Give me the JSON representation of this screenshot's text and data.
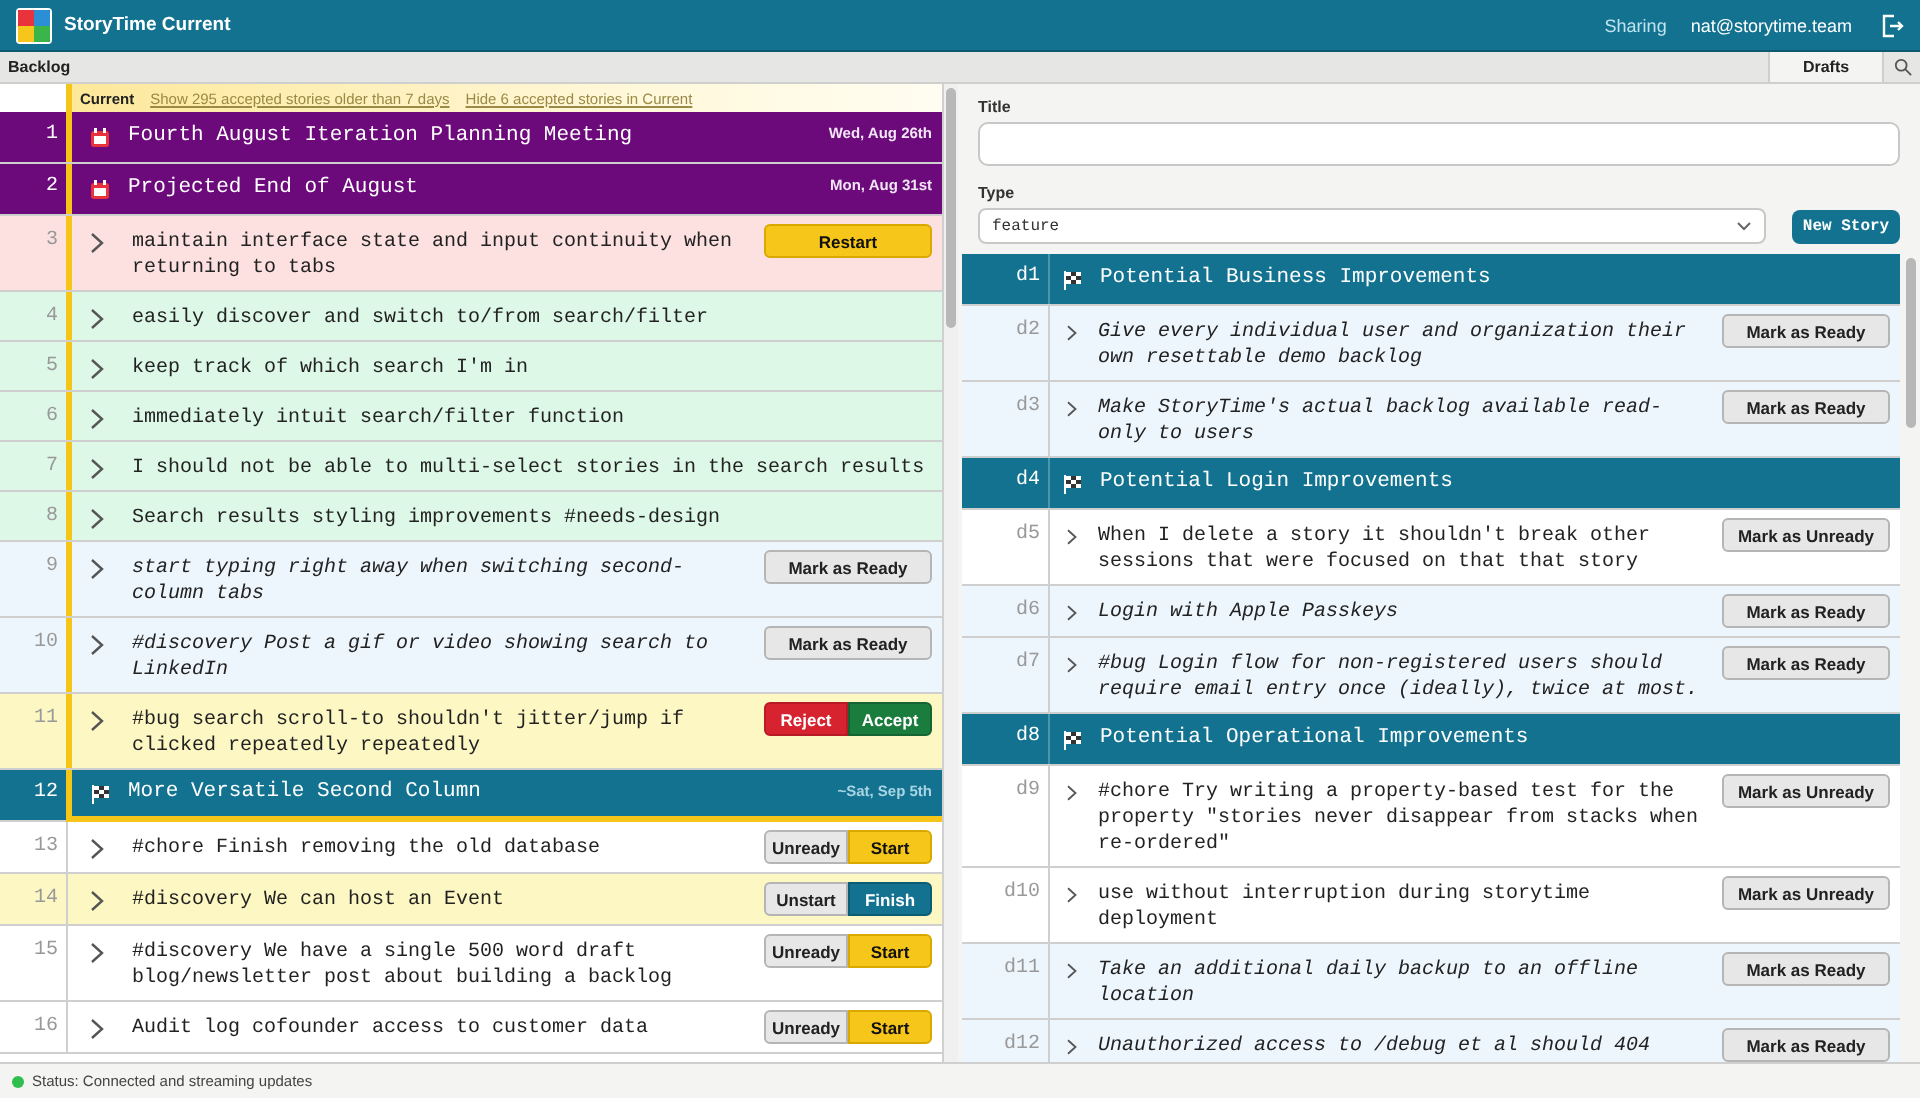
{
  "header": {
    "app_name": "StoryTime Current",
    "links": [
      "Sharing",
      "nat@storytime.team"
    ]
  },
  "backlog": {
    "title": "Backlog",
    "current": {
      "label": "Current",
      "links": [
        "Show 295 accepted stories older than 7 days",
        "Hide 6 accepted stories in Current"
      ],
      "rows": [
        {
          "number": "1",
          "kind": "event",
          "title": "Fourth August Iteration Planning Meeting",
          "date": "Wed, Aug 26th"
        },
        {
          "number": "2",
          "kind": "event",
          "title": "Projected End of August",
          "date": "Mon, Aug 31st"
        },
        {
          "number": "3",
          "kind": "rejected",
          "title": "maintain interface state and input continuity when returning to tabs",
          "buttons": [
            {
              "label": "Restart",
              "kind": "primary"
            }
          ]
        },
        {
          "number": "4",
          "kind": "accepted",
          "title": "easily discover and switch to/from search/filter"
        },
        {
          "number": "5",
          "kind": "accepted",
          "title": "keep track of which search I'm in"
        },
        {
          "number": "6",
          "kind": "accepted",
          "title": "immediately intuit search/filter function"
        },
        {
          "number": "7",
          "kind": "accepted",
          "title": "I should not be able to multi-select stories in the search results"
        },
        {
          "number": "8",
          "kind": "accepted",
          "title": "Search results styling improvements #needs-design"
        },
        {
          "number": "9",
          "kind": "unready",
          "title": "start typing right away when switching second-column tabs",
          "buttons": [
            {
              "label": "Mark as Ready",
              "kind": "neutral"
            }
          ]
        },
        {
          "number": "10",
          "kind": "unready",
          "title": "#discovery Post a gif or video showing search to LinkedIn",
          "buttons": [
            {
              "label": "Mark as Ready",
              "kind": "neutral"
            }
          ]
        },
        {
          "number": "11",
          "kind": "delivered",
          "title": "#bug search scroll-to shouldn't jitter/jump if clicked repeatedly repeatedly",
          "buttons": [
            {
              "label": "Reject",
              "kind": "reject"
            },
            {
              "label": "Accept",
              "kind": "accept"
            }
          ]
        },
        {
          "number": "12",
          "kind": "milestone",
          "title": "More Versatile Second Column",
          "date": "~Sat, Sep 5th"
        }
      ]
    },
    "rows": [
      {
        "number": "13",
        "kind": "ready",
        "title": "#chore Finish removing the old database",
        "buttons": [
          {
            "label": "Unready",
            "kind": "neutral"
          },
          {
            "label": "Start",
            "kind": "primary"
          }
        ]
      },
      {
        "number": "14",
        "kind": "started",
        "title": "#discovery We can host an Event",
        "buttons": [
          {
            "label": "Unstart",
            "kind": "neutral"
          },
          {
            "label": "Finish",
            "kind": "finish"
          }
        ]
      },
      {
        "number": "15",
        "kind": "ready",
        "title": "#discovery We have a single 500 word draft blog/newsletter post about building a backlog",
        "buttons": [
          {
            "label": "Unready",
            "kind": "neutral"
          },
          {
            "label": "Start",
            "kind": "primary"
          }
        ]
      },
      {
        "number": "16",
        "kind": "ready",
        "title": "Audit log cofounder access to customer data",
        "buttons": [
          {
            "label": "Unready",
            "kind": "neutral"
          },
          {
            "label": "Start",
            "kind": "primary"
          }
        ]
      }
    ]
  },
  "drafts": {
    "tabs": [
      {
        "label": "Drafts",
        "selected": true
      }
    ],
    "form": {
      "title_label": "Title",
      "type_label": "Type",
      "type_value": "feature",
      "submit": "New Story"
    },
    "rows": [
      {
        "number": "d1",
        "kind": "milestone",
        "title": "Potential Business Improvements"
      },
      {
        "number": "d2",
        "kind": "unready",
        "title": "Give every individual user and organization their own resettable demo backlog",
        "buttons": [
          {
            "label": "Mark as Ready",
            "kind": "neutral"
          }
        ]
      },
      {
        "number": "d3",
        "kind": "unready",
        "title": "Make StoryTime's actual backlog available read-only to users",
        "buttons": [
          {
            "label": "Mark as Ready",
            "kind": "neutral"
          }
        ]
      },
      {
        "number": "d4",
        "kind": "milestone",
        "title": "Potential Login Improvements"
      },
      {
        "number": "d5",
        "kind": "ready",
        "title": "When I delete a story it shouldn't break other sessions that were focused on that that story",
        "buttons": [
          {
            "label": "Mark as Unready",
            "kind": "neutral"
          }
        ]
      },
      {
        "number": "d6",
        "kind": "unready",
        "title": "Login with Apple Passkeys",
        "buttons": [
          {
            "label": "Mark as Ready",
            "kind": "neutral"
          }
        ]
      },
      {
        "number": "d7",
        "kind": "unready",
        "title": "#bug Login flow for non-registered users should require email entry once (ideally), twice at most.",
        "buttons": [
          {
            "label": "Mark as Ready",
            "kind": "neutral"
          }
        ]
      },
      {
        "number": "d8",
        "kind": "milestone",
        "title": "Potential Operational Improvements"
      },
      {
        "number": "d9",
        "kind": "ready",
        "title": "#chore Try writing a property-based test for the property \"stories never disappear from stacks when re-ordered\"",
        "buttons": [
          {
            "label": "Mark as Unready",
            "kind": "neutral"
          }
        ]
      },
      {
        "number": "d10",
        "kind": "ready",
        "title": "use without interruption during storytime deployment",
        "buttons": [
          {
            "label": "Mark as Unready",
            "kind": "neutral"
          }
        ]
      },
      {
        "number": "d11",
        "kind": "unready",
        "title": "Take an additional daily backup to an offline location",
        "buttons": [
          {
            "label": "Mark as Ready",
            "kind": "neutral"
          }
        ]
      },
      {
        "number": "d12",
        "kind": "unready",
        "title": "Unauthorized access to /debug et al should 404",
        "buttons": [
          {
            "label": "Mark as Ready",
            "kind": "neutral"
          }
        ]
      }
    ]
  },
  "status_bar": {
    "text": "Status: Connected and streaming updates",
    "connected": true
  }
}
